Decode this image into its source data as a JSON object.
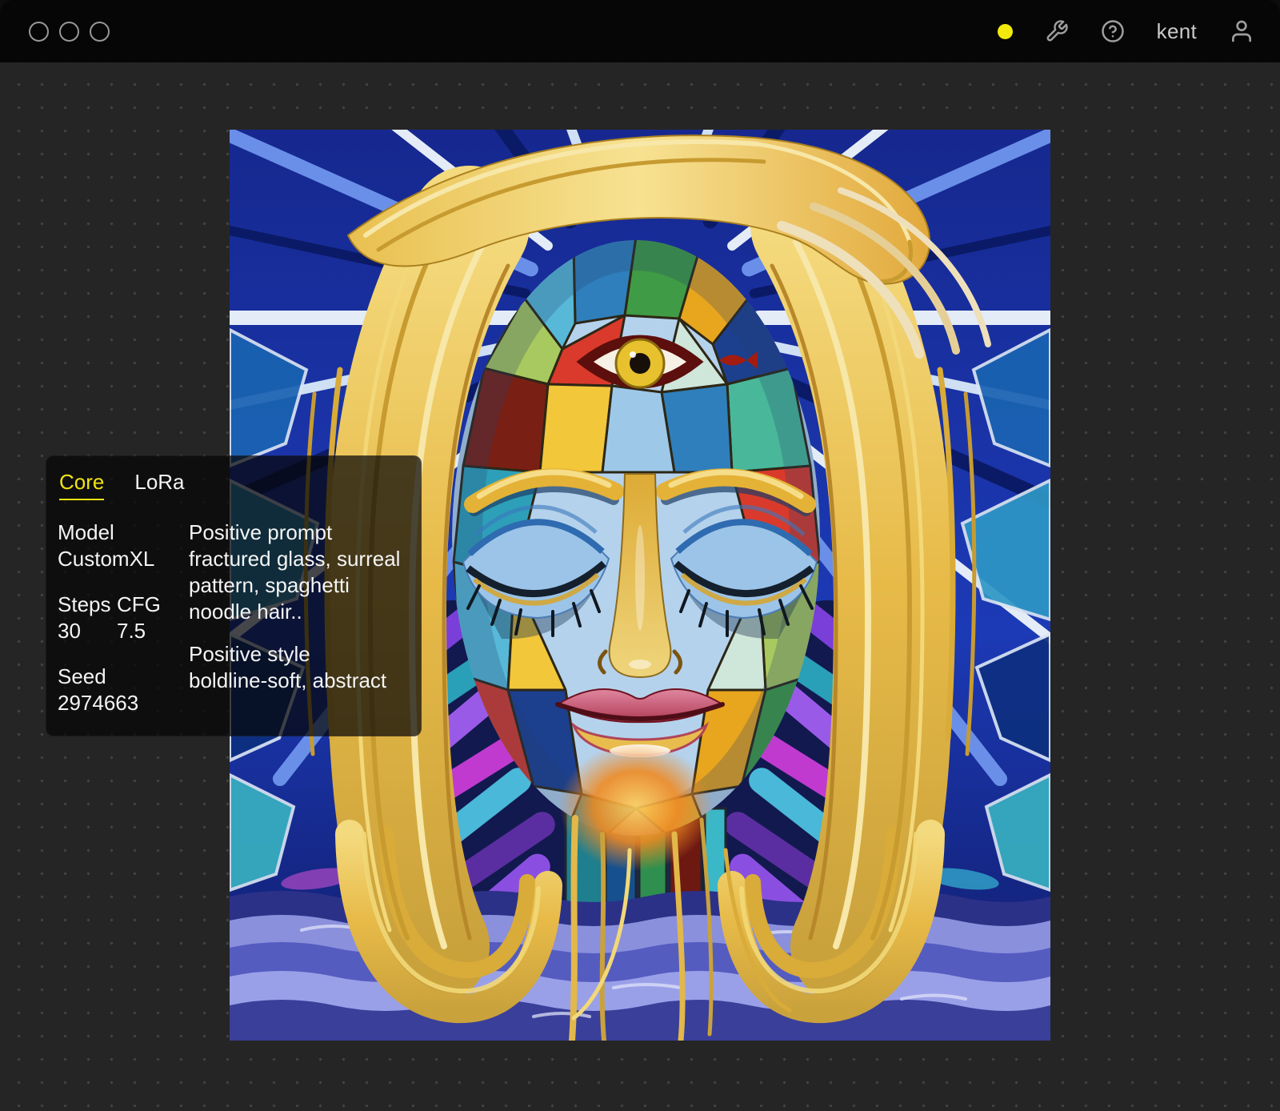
{
  "titlebar": {
    "window_controls": [
      "circle",
      "circle",
      "circle"
    ],
    "status_dot_color": "#f2ea0c",
    "icons": [
      "wrench-icon",
      "help-icon",
      "user-icon"
    ],
    "username": "kent"
  },
  "workspace": {
    "background_color": "#252525",
    "dot_color": "#414141"
  },
  "image": {
    "description": "AI-generated surreal stained-glass mosaic portrait of a woman with golden spaghetti-noodle hair, closed blue eyelids, a third eye on the forehead, cobalt blue radiating glass background, purple feathered sides and rippled blue-violet base"
  },
  "panel": {
    "accent_color": "#f2e312",
    "tabs": [
      {
        "label": "Core",
        "active": true
      },
      {
        "label": "LoRa",
        "active": false
      }
    ],
    "fields": {
      "model": {
        "label": "Model",
        "value": "CustomXL"
      },
      "steps": {
        "label": "Steps",
        "value": "30"
      },
      "cfg": {
        "label": "CFG",
        "value": "7.5"
      },
      "seed": {
        "label": "Seed",
        "value": "2974663"
      },
      "positive_prompt": {
        "label": "Positive prompt",
        "value": "fractured glass, surreal pattern, spaghetti noodle hair.."
      },
      "positive_style": {
        "label": "Positive style",
        "value": "boldline-soft, abstract"
      }
    }
  }
}
